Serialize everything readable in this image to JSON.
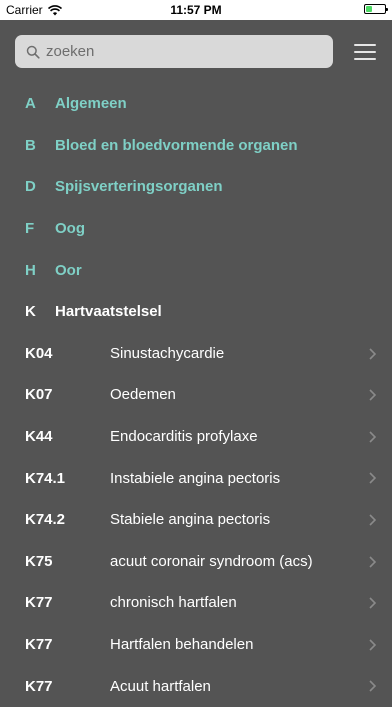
{
  "status_bar": {
    "carrier": "Carrier",
    "time": "11:57 PM",
    "battery_color": "#4cd964",
    "wifi_icon": "wifi-icon"
  },
  "search": {
    "placeholder": "zoeken",
    "icon": "search-icon"
  },
  "menu": {
    "icon": "hamburger-menu-icon"
  },
  "colors": {
    "background": "#545454",
    "section_text": "#7fd0c6",
    "search_field": "#d9d9d9"
  },
  "list": {
    "sections": [
      {
        "code": "A",
        "name": "Algemeen"
      },
      {
        "code": "B",
        "name": "Bloed en bloedvormende organen"
      },
      {
        "code": "D",
        "name": "Spijsverteringsorganen"
      },
      {
        "code": "F",
        "name": "Oog"
      },
      {
        "code": "H",
        "name": "Oor"
      }
    ],
    "active_section": {
      "code": "K",
      "name": "Hartvaatstelsel"
    },
    "items": [
      {
        "code": "K04",
        "name": "Sinustachycardie"
      },
      {
        "code": "K07",
        "name": "Oedemen"
      },
      {
        "code": "K44",
        "name": "Endocarditis profylaxe"
      },
      {
        "code": "K74.1",
        "name": "Instabiele angina pectoris"
      },
      {
        "code": "K74.2",
        "name": "Stabiele angina pectoris"
      },
      {
        "code": "K75",
        "name": "acuut coronair syndroom (acs)"
      },
      {
        "code": "K77",
        "name": "chronisch hartfalen"
      },
      {
        "code": "K77",
        "name": "Hartfalen behandelen"
      },
      {
        "code": "K77",
        "name": "Acuut hartfalen"
      }
    ]
  }
}
